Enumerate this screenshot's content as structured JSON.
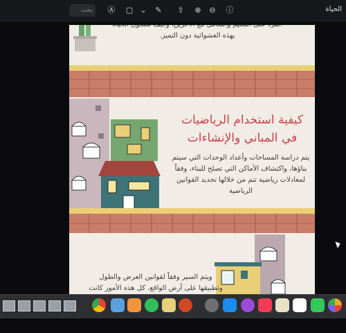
{
  "toolbar": {
    "window_title": "الحياة",
    "search_placeholder": "بحث"
  },
  "document": {
    "panel1_text_line1": "الفرد على التعليم والتعامل مع الآخرين، وكيف ستكون الحياة",
    "panel1_text_line2": "بهذه العشوائية دون التميز.",
    "panel2_heading_line1": "كيفية استخدام الرياضيات",
    "panel2_heading_line2": "في المباني والإنشاءات",
    "panel2_text_line1": "يتم دراسة المساحات وأعداد الوحدات التي سيتم",
    "panel2_text_line2": "بناؤها، واكتشاف الأماكن التي تصلح للبناء، وفقاً",
    "panel2_text_line3": "لمعادلات رياضية تتم من خلالها تحديد القوانين",
    "panel2_text_line4": "الرياضية",
    "panel3_text_line1": "ويتم السير وفقاً لقوانين العرض والطول",
    "panel3_text_line2": "وتطبيقها على أرض الواقع، كل هذه الأمور كانت"
  },
  "dock": {
    "apps": [
      "finder",
      "launchpad",
      "safari",
      "chrome",
      "photos",
      "pages",
      "whatsapp",
      "notes",
      "powerpoint",
      "settings",
      "app-store",
      "podcasts",
      "music",
      "files",
      "calendar",
      "facetime",
      "photos-app"
    ]
  },
  "colors": {
    "heading": "#c8434c",
    "brick": "#c97d69",
    "yellow": "#e9cf76"
  }
}
